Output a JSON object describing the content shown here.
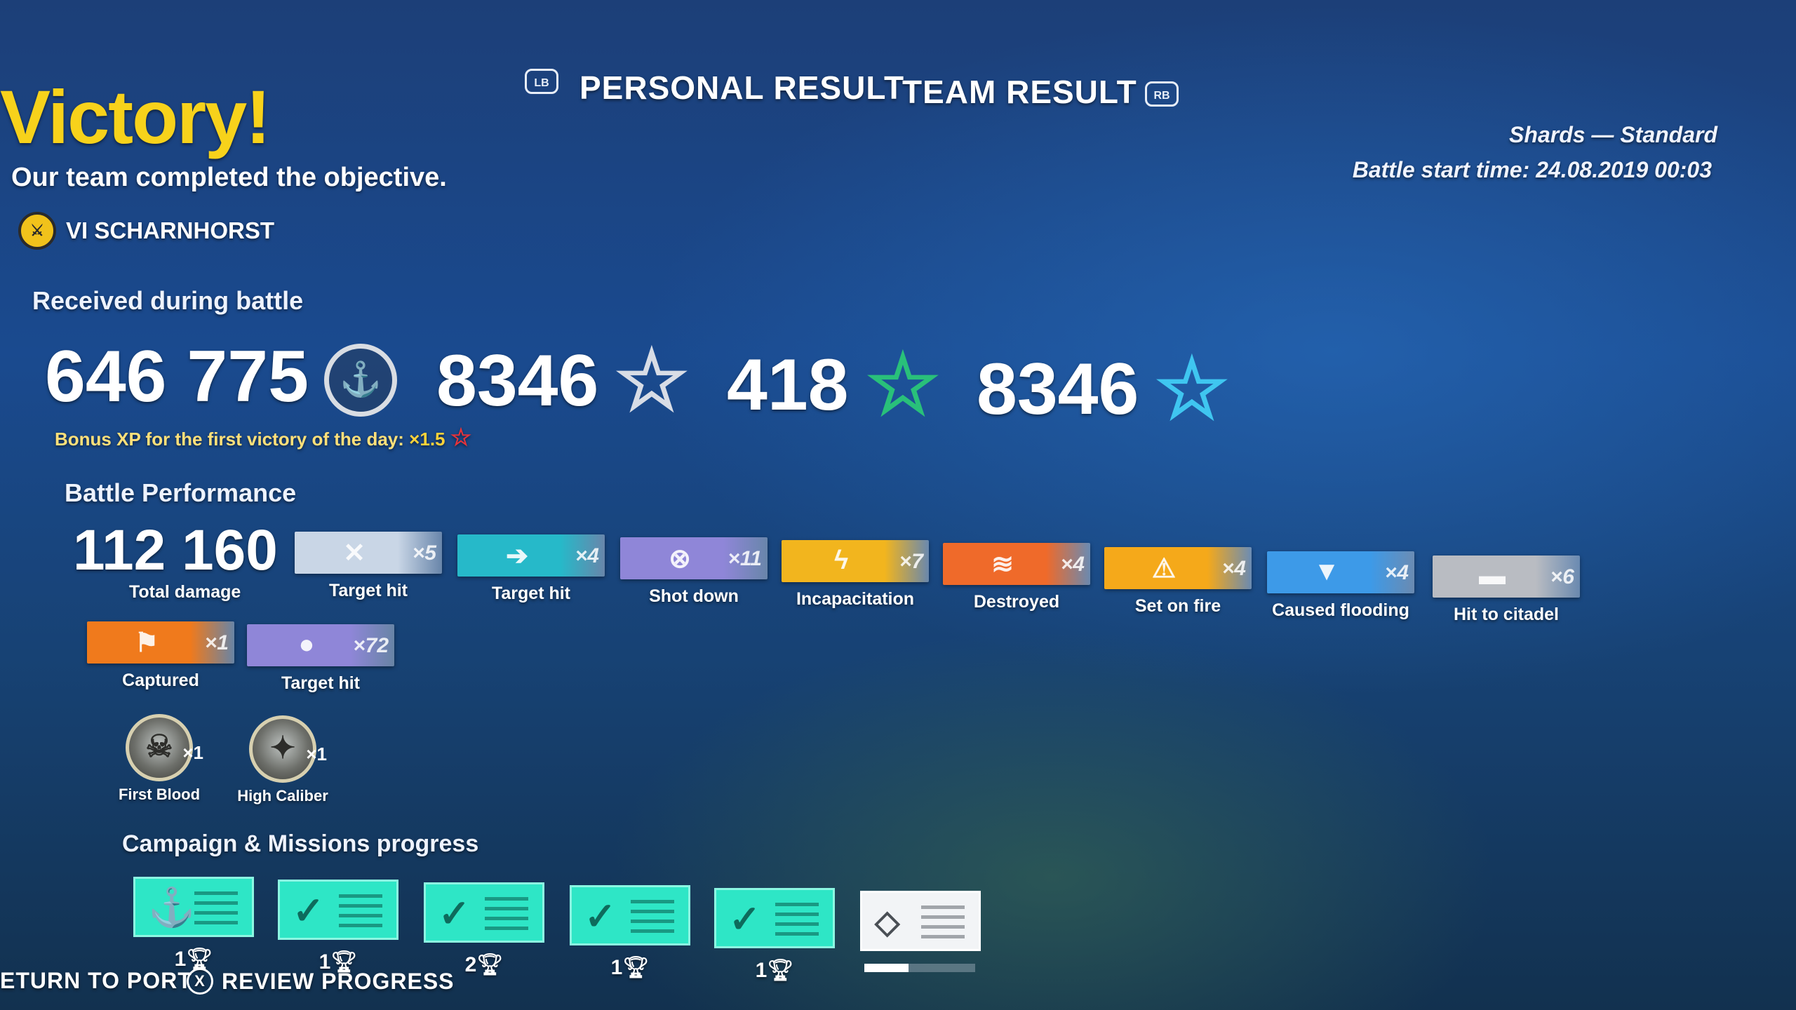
{
  "header": {
    "left_bumper": "LB",
    "right_bumper": "RB",
    "tab_personal": "PERSONAL RESULT",
    "tab_team": "TEAM RESULT"
  },
  "result": {
    "title": "Victory!",
    "subtitle": "Our team completed the objective.",
    "ship": "VI SCHARNHORST"
  },
  "battle_info": {
    "mode": "Shards — Standard",
    "start_time": "Battle start time: 24.08.2019 00:03"
  },
  "received": {
    "heading": "Received during battle",
    "credits": "646 775",
    "xp": "8346",
    "commander_xp": "418",
    "free_xp": "8346",
    "bonus_text": "Bonus XP for the first victory of the day:",
    "bonus_multiplier": "×1.5"
  },
  "performance": {
    "heading": "Battle Performance",
    "total_damage": "112 160",
    "total_damage_label": "Total damage",
    "ribbons": [
      {
        "label": "Target hit",
        "count": "×5",
        "color": "#c9d6e6",
        "icon": "crossed-shells-icon",
        "glyph": "✕"
      },
      {
        "label": "Target hit",
        "count": "×4",
        "color": "#26b9c9",
        "icon": "torpedo-icon",
        "glyph": "➔"
      },
      {
        "label": "Shot down",
        "count": "×11",
        "color": "#8f86d8",
        "icon": "plane-crosshair-icon",
        "glyph": "⊗"
      },
      {
        "label": "Incapacitation",
        "count": "×7",
        "color": "#f2b51e",
        "icon": "lightning-icon",
        "glyph": "ϟ"
      },
      {
        "label": "Destroyed",
        "count": "×4",
        "color": "#ef6a2a",
        "icon": "sinking-ship-icon",
        "glyph": "≋"
      },
      {
        "label": "Set on fire",
        "count": "×4",
        "color": "#f5a91a",
        "icon": "fire-warning-icon",
        "glyph": "⚠"
      },
      {
        "label": "Caused flooding",
        "count": "×4",
        "color": "#3d9ae8",
        "icon": "flooding-icon",
        "glyph": "▼"
      },
      {
        "label": "Hit to citadel",
        "count": "×6",
        "color": "#b9bcc2",
        "icon": "ship-silhouette-icon",
        "glyph": "▬"
      },
      {
        "label": "Captured",
        "count": "×1",
        "color": "#f07a1c",
        "icon": "flag-icon",
        "glyph": "⚑"
      },
      {
        "label": "Target hit",
        "count": "×72",
        "color": "#8f86d8",
        "icon": "bombs-icon",
        "glyph": "●"
      }
    ],
    "medals": [
      {
        "label": "First Blood",
        "count": "×1",
        "icon": "first-blood-medal-icon",
        "glyph": "☠"
      },
      {
        "label": "High Caliber",
        "count": "×1",
        "icon": "high-caliber-medal-icon",
        "glyph": "✦"
      }
    ]
  },
  "missions": {
    "heading": "Campaign & Missions progress",
    "items": [
      {
        "reward": "1",
        "status": "complete",
        "icon": "anchor-icon",
        "glyph": "⚓",
        "progress": 1.0
      },
      {
        "reward": "1",
        "status": "complete",
        "icon": "checkmark-icon",
        "glyph": "✓",
        "progress": 1.0
      },
      {
        "reward": "2",
        "status": "complete",
        "icon": "checkmark-icon",
        "glyph": "✓",
        "progress": 1.0
      },
      {
        "reward": "1",
        "status": "complete",
        "icon": "checkmark-icon",
        "glyph": "✓",
        "progress": 1.0
      },
      {
        "reward": "1",
        "status": "complete",
        "icon": "checkmark-icon",
        "glyph": "✓",
        "progress": 1.0
      },
      {
        "reward": "",
        "status": "in-progress",
        "icon": "diamond-alert-icon",
        "glyph": "◇",
        "progress": 0.4
      }
    ]
  },
  "footer": {
    "return_label": "ETURN TO PORT",
    "review_button": "X",
    "review_label": "REVIEW PROGRESS"
  },
  "colors": {
    "victory": "#f7d21b",
    "xp_star": "#d8dde6",
    "commander_star": "#29c07a",
    "free_xp_star": "#3fc6f0",
    "bonus_star": "#e8333a",
    "bonus_highlight": "#ffd23a",
    "mission_complete": "#2ee6c6"
  }
}
